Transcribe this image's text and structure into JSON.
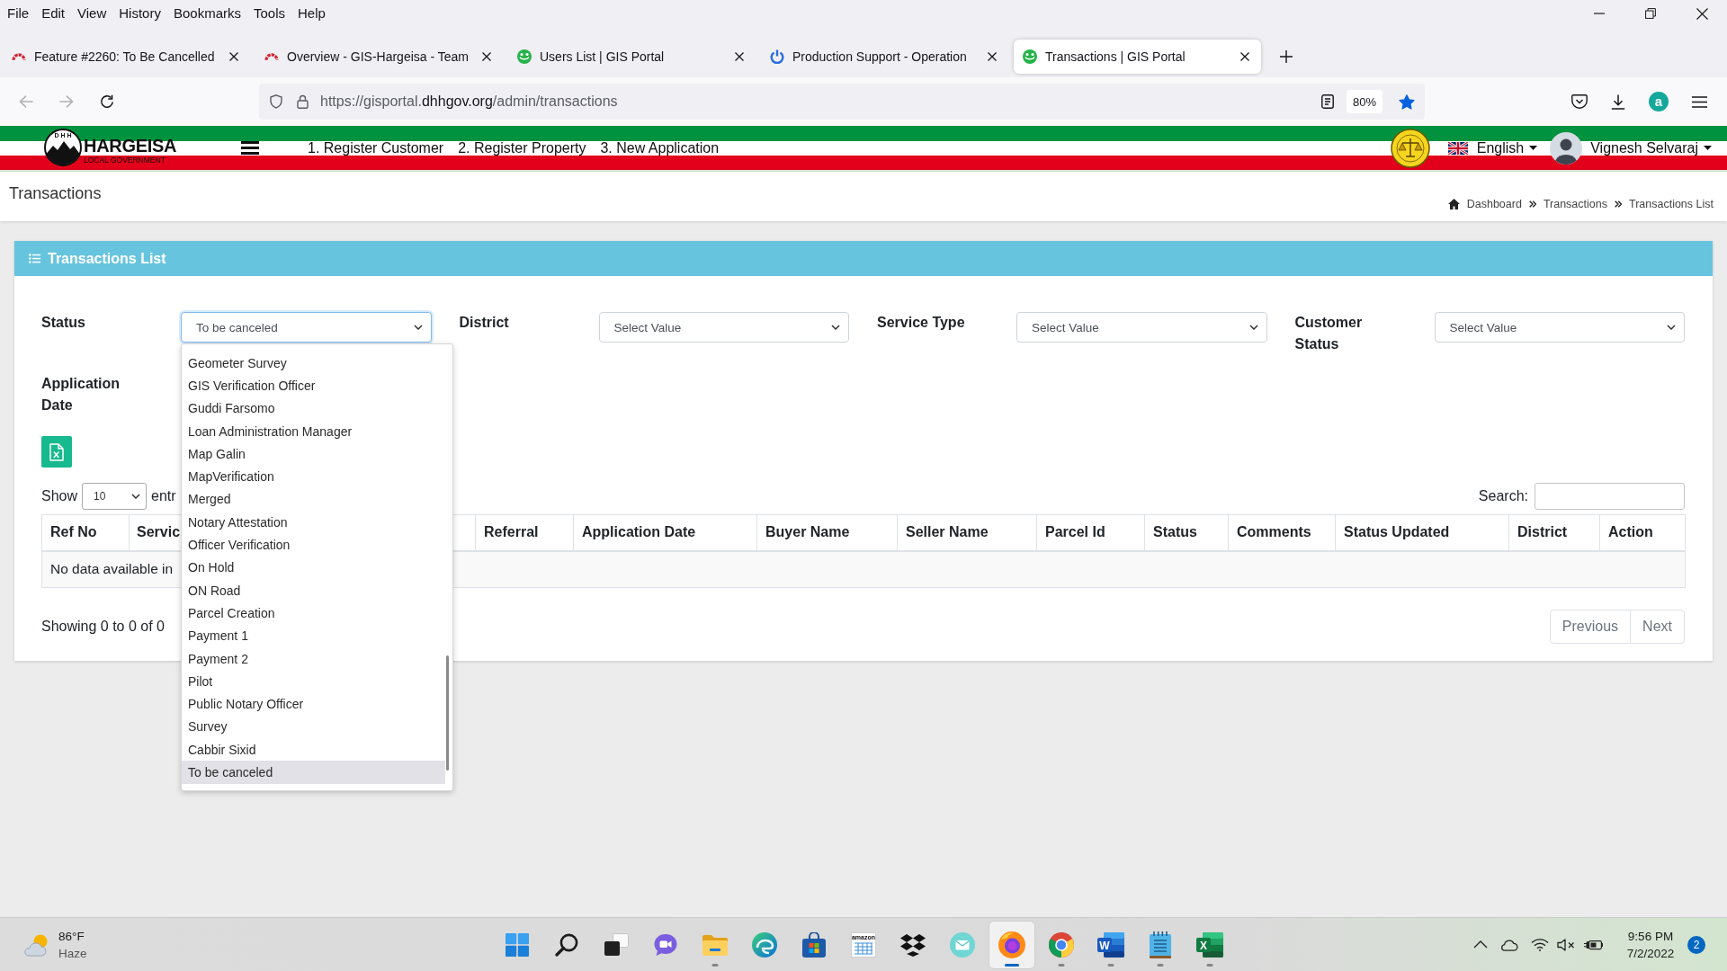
{
  "menu_bar": {
    "items": [
      "File",
      "Edit",
      "View",
      "History",
      "Bookmarks",
      "Tools",
      "Help"
    ]
  },
  "browser_tabs": [
    {
      "title": "Feature #2260: To Be Cancelled",
      "selected": false
    },
    {
      "title": "Overview - GIS-Hargeisa - Team",
      "selected": false
    },
    {
      "title": "Users List | GIS Portal",
      "selected": false
    },
    {
      "title": "Production Support - Operation",
      "selected": false
    },
    {
      "title": "Transactions | GIS Portal",
      "selected": true
    }
  ],
  "toolbar": {
    "back_disabled": true,
    "forward_disabled": true,
    "address": {
      "before": "https://gisportal.",
      "domain": "dhhgov.org",
      "after": "/admin/transactions"
    },
    "zoom": "80%",
    "bookmarked": true,
    "account_initial": "a"
  },
  "app_header": {
    "logo": {
      "initials": "D H H",
      "title": "HARGEISA",
      "subtitle": "LOCAL GOVERNMENT"
    },
    "nav_links": [
      "1. Register Customer",
      "2. Register Property",
      "3. New Application"
    ],
    "language": "English",
    "user": "Vignesh Selvaraj"
  },
  "page_header": {
    "title": "Transactions",
    "breadcrumb": [
      "Dashboard",
      "Transactions",
      "Transactions List"
    ]
  },
  "card": {
    "title": "Transactions List",
    "filters": [
      {
        "label": "Status",
        "value": "To be canceled",
        "focused": true,
        "expanded": true,
        "options": [
          {
            "label": "Geometer Survey",
            "selected": false
          },
          {
            "label": "GIS Verification Officer",
            "selected": false
          },
          {
            "label": "Guddi Farsomo",
            "selected": false
          },
          {
            "label": "Loan Administration Manager",
            "selected": false
          },
          {
            "label": "Map Galin",
            "selected": false
          },
          {
            "label": "MapVerification",
            "selected": false
          },
          {
            "label": "Merged",
            "selected": false
          },
          {
            "label": "Notary Attestation",
            "selected": false
          },
          {
            "label": "Officer Verification",
            "selected": false
          },
          {
            "label": "On Hold",
            "selected": false
          },
          {
            "label": "ON Road",
            "selected": false
          },
          {
            "label": "Parcel Creation",
            "selected": false
          },
          {
            "label": "Payment 1",
            "selected": false
          },
          {
            "label": "Payment 2",
            "selected": false
          },
          {
            "label": "Pilot",
            "selected": false
          },
          {
            "label": "Public Notary Officer",
            "selected": false
          },
          {
            "label": "Survey",
            "selected": false
          },
          {
            "label": "Cabbir Sixid",
            "selected": false
          },
          {
            "label": "To be canceled",
            "selected": true
          }
        ]
      },
      {
        "label": "District",
        "value": "Select Value",
        "focused": false,
        "expanded": false
      },
      {
        "label": "Service Type",
        "value": "Select Value",
        "focused": false,
        "expanded": false
      },
      {
        "label": "Customer Status",
        "value": "Select Value",
        "focused": false,
        "expanded": false
      }
    ],
    "date_filter": {
      "label": "Application Date"
    },
    "length_menu": {
      "before": "Show",
      "value": "10",
      "after": "entr"
    },
    "search": {
      "label": "Search:"
    },
    "table": {
      "columns": [
        "Ref No",
        "Servic",
        "Referral",
        "Application Date",
        "Buyer Name",
        "Seller Name",
        "Parcel Id",
        "Status",
        "Comments",
        "Status Updated",
        "District",
        "Action"
      ],
      "empty_message": "No data available in"
    },
    "info": "Showing 0 to 0 of 0",
    "pagination": [
      {
        "label": "Previous",
        "disabled": true
      },
      {
        "label": "Next",
        "disabled": true
      }
    ]
  },
  "taskbar": {
    "weather": {
      "temperature": "86°F",
      "condition": "Haze"
    },
    "apps": [
      {
        "running": false,
        "selected": false
      },
      {
        "running": false,
        "selected": false
      },
      {
        "running": false,
        "selected": false
      },
      {
        "running": false,
        "selected": false
      },
      {
        "running": true,
        "selected": false
      },
      {
        "running": false,
        "selected": false
      },
      {
        "running": false,
        "selected": false
      },
      {
        "running": false,
        "selected": false,
        "label": "amazon"
      },
      {
        "running": false,
        "selected": false
      },
      {
        "running": false,
        "selected": false
      },
      {
        "running": true,
        "selected": true
      },
      {
        "running": true,
        "selected": false
      },
      {
        "running": true,
        "selected": false,
        "label": "W"
      },
      {
        "running": true,
        "selected": false
      },
      {
        "running": true,
        "selected": false,
        "label": "X"
      }
    ],
    "tray": {
      "volume_muted": true,
      "time": "9:56 PM",
      "date": "7/2/2022",
      "notifications": "2"
    }
  }
}
